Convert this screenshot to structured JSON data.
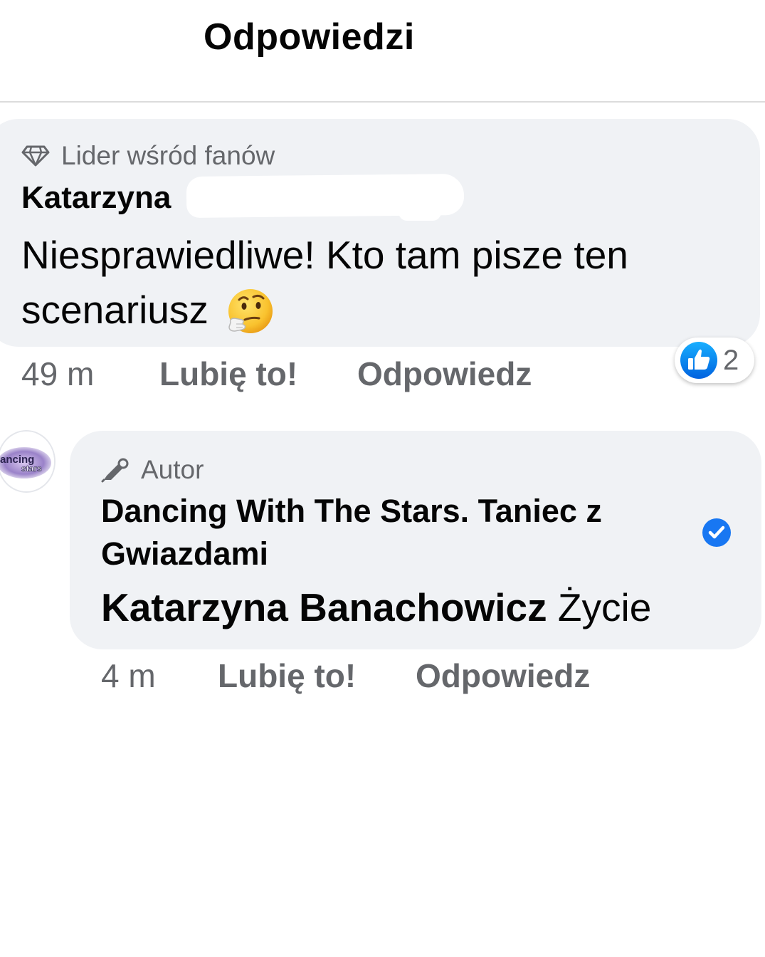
{
  "header": {
    "title": "Odpowiedzi"
  },
  "comments": [
    {
      "badge": "Lider wśród fanów",
      "badge_icon": "diamond-icon",
      "author": "Katarzyna",
      "text": "Niesprawiedliwe! Kto tam pisze ten scenariusz",
      "emoji": "thinking-face-emoji",
      "time": "49 m",
      "like_label": "Lubię to!",
      "reply_label": "Odpowiedz",
      "reactions": {
        "icon": "like-reaction-icon",
        "count": "2"
      }
    },
    {
      "badge": "Autor",
      "badge_icon": "microphone-pen-icon",
      "author": "Dancing With The Stars. Taniec z Gwiazdami",
      "verified": true,
      "mention": "Katarzyna Banachowicz",
      "text": "Życie",
      "time": "4 m",
      "like_label": "Lubię to!",
      "reply_label": "Odpowiedz",
      "avatar": {
        "text_line1": "ancing",
        "text_line2": "stars"
      }
    }
  ],
  "colors": {
    "bubble": "#f0f2f5",
    "secondary_text": "#65676b",
    "facebook_blue": "#1877f2",
    "divider": "#dcdcdc"
  }
}
